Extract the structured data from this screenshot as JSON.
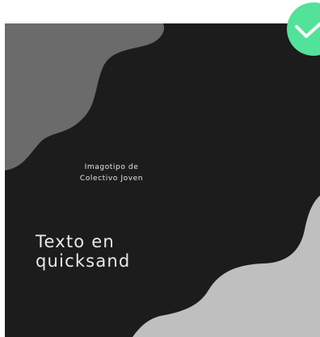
{
  "canvas": {
    "background_color": "#1c1c1c",
    "shape_colors": {
      "top_left_blob": "#6b6b6b",
      "bottom_right_blob": "#bfbfbf"
    }
  },
  "caption": {
    "line1": "Imagotipo de",
    "line2": "Colectivo Joven"
  },
  "headline": {
    "line1": "Texto en",
    "line2": "quicksand"
  },
  "selection_badge": {
    "icon": "check-icon",
    "color": "#52e29a",
    "selected": true
  }
}
